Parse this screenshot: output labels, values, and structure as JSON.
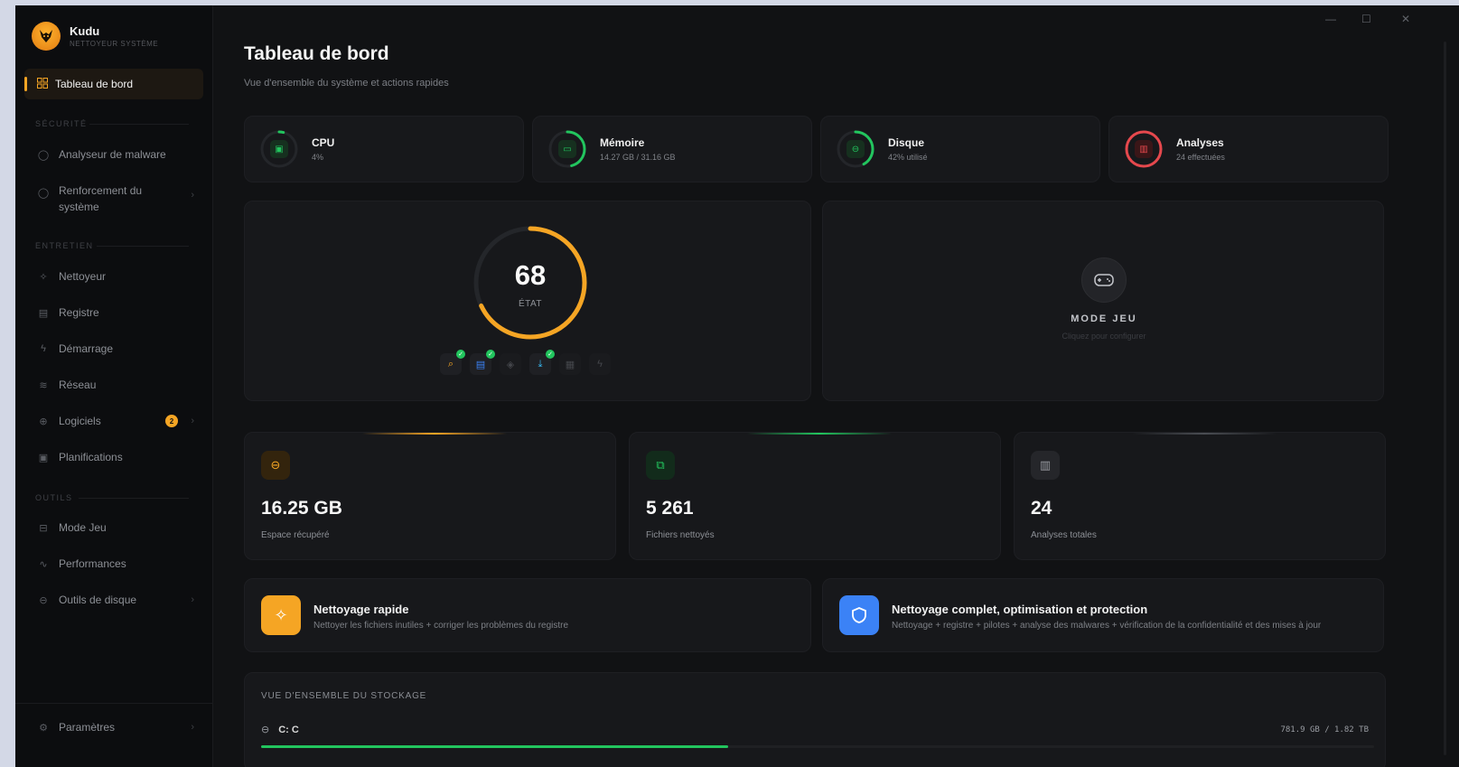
{
  "app": {
    "name": "Kudu",
    "subtitle": "NETTOYEUR SYSTÈME"
  },
  "sidebar": {
    "active": {
      "label": "Tableau de bord",
      "icon": "grid-icon"
    },
    "sections": {
      "security": "SÉCURITÉ",
      "maintenance": "ENTRETIEN",
      "tools": "OUTILS"
    },
    "items": [
      {
        "label": "Analyseur de malware",
        "icon": "shield-icon"
      },
      {
        "label": "Renforcement du",
        "label2": "système",
        "icon": "shield-check-icon"
      },
      {
        "label": "Nettoyeur",
        "icon": "sparkles-icon"
      },
      {
        "label": "Registre",
        "icon": "database-icon"
      },
      {
        "label": "Démarrage",
        "icon": "zap-icon"
      },
      {
        "label": "Réseau",
        "icon": "wifi-icon"
      },
      {
        "label": "Logiciels",
        "icon": "package-icon",
        "badge": "2"
      },
      {
        "label": "Planifications",
        "icon": "calendar-icon"
      },
      {
        "label": "Mode Jeu",
        "icon": "gamepad-icon"
      },
      {
        "label": "Performances",
        "icon": "activity-icon"
      },
      {
        "label": "Outils de disque",
        "icon": "hard-drive-icon"
      }
    ],
    "settings": {
      "label": "Paramètres",
      "icon": "gear-icon"
    }
  },
  "window_controls": {
    "minimize": "—",
    "maximize": "☐",
    "close": "✕"
  },
  "header": {
    "title": "Tableau de bord",
    "subtitle": "Vue d'ensemble du système et actions rapides"
  },
  "stats": [
    {
      "label": "CPU",
      "value": "4%",
      "percent": 4,
      "color": "#22c55e",
      "icon": "cpu-icon"
    },
    {
      "label": "Mémoire",
      "value": "14.27 GB / 31.16 GB",
      "percent": 46,
      "color": "#22c55e",
      "icon": "memory-icon"
    },
    {
      "label": "Disque",
      "value": "42% utilisé",
      "percent": 42,
      "color": "#22c55e",
      "icon": "hard-drive-icon"
    },
    {
      "label": "Analyses",
      "value": "24 effectuées",
      "percent": 100,
      "color": "#e5484d",
      "icon": "bar-chart-icon"
    }
  ],
  "health": {
    "score": "68",
    "label": "ÉTAT",
    "percent": 68,
    "color": "#f5a524"
  },
  "health_icons": [
    {
      "icon": "search-icon",
      "checked": true,
      "color": "#f5a524"
    },
    {
      "icon": "database-icon",
      "checked": true,
      "color": "#3b82f6"
    },
    {
      "icon": "shield-icon",
      "checked": false,
      "color": "#44464b"
    },
    {
      "icon": "download-icon",
      "checked": true,
      "color": "#38bdf8"
    },
    {
      "icon": "grid-icon",
      "checked": false,
      "color": "#44464b"
    },
    {
      "icon": "zap-icon",
      "checked": false,
      "color": "#44464b"
    }
  ],
  "game_mode": {
    "title": "MODE JEU",
    "subtitle": "Cliquez pour configurer"
  },
  "totals": [
    {
      "value": "16.25 GB",
      "label": "Espace récupéré",
      "color": "#f5a524",
      "icon": "hard-drive-icon"
    },
    {
      "value": "5 261",
      "label": "Fichiers nettoyés",
      "color": "#22c55e",
      "icon": "files-icon"
    },
    {
      "value": "24",
      "label": "Analyses totales",
      "color": "#9a9da3",
      "icon": "bar-chart-icon"
    }
  ],
  "actions": [
    {
      "title": "Nettoyage rapide",
      "subtitle": "Nettoyer les fichiers inutiles + corriger les problèmes du registre",
      "color": "#f5a524",
      "icon": "sparkles-icon"
    },
    {
      "title": "Nettoyage complet, optimisation et protection",
      "subtitle": "Nettoyage + registre + pilotes + analyse des malwares + vérification de la confidentialité et des mises à jour",
      "color": "#3b82f6",
      "icon": "shield-icon"
    }
  ],
  "storage": {
    "title": "VUE D'ENSEMBLE DU STOCKAGE",
    "drives": [
      {
        "name": "C: C",
        "size": "781.9 GB / 1.82 TB",
        "percent": 42
      }
    ]
  }
}
